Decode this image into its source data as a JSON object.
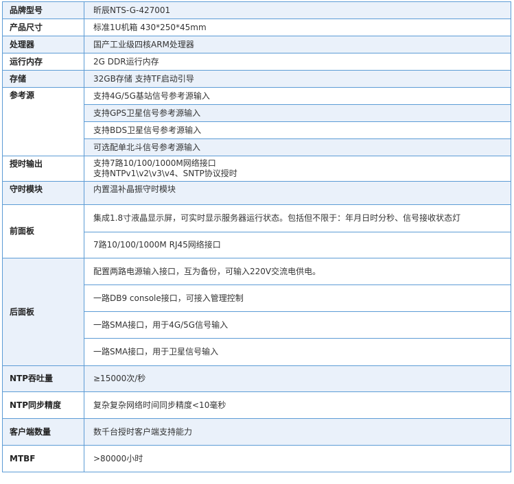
{
  "rows": {
    "model": {
      "label": "品牌型号",
      "value": "昕辰NTS-G-427001"
    },
    "size": {
      "label": "产品尺寸",
      "value": "标准1U机箱  430*250*45mm"
    },
    "cpu": {
      "label": "处理器",
      "value": "国产工业级四核ARM处理器"
    },
    "memory": {
      "label": "运行内存",
      "value": "2G DDR运行内存"
    },
    "storage": {
      "label": "存储",
      "value": "32GB存储 支持TF启动引导"
    },
    "reference": {
      "label": "参考源",
      "items": [
        "支持4G/5G基站信号参考源输入",
        "支持GPS卫星信号参考源输入",
        "支持BDS卫星信号参考源输入",
        "可选配单北斗信号参考源输入"
      ]
    },
    "timing_output": {
      "label": "授时输出",
      "lines": [
        "支持7路10/100/1000M网络接口",
        "支持NTPv1\\v2\\v3\\v4、SNTP协议授时"
      ]
    },
    "holdover": {
      "label": "守时模块",
      "value": "内置温补晶振守时模块"
    },
    "front_panel": {
      "label": "前面板",
      "items": [
        "集成1.8寸液晶显示屏，可实时显示服务器运行状态。包括但不限于：年月日时分秒、信号接收状态灯",
        "7路10/100/1000M RJ45网络接口"
      ]
    },
    "rear_panel": {
      "label": "后面板",
      "items": [
        "配置两路电源输入接口，互为备份，可输入220V交流电供电。",
        "一路DB9 console接口，可接入管理控制",
        "一路SMA接口，用于4G/5G信号输入",
        "一路SMA接口，用于卫星信号输入"
      ]
    },
    "ntp_throughput": {
      "label": "NTP吞吐量",
      "value": "≥15000次/秒"
    },
    "ntp_precision": {
      "label": "NTP同步精度",
      "value": "复杂复杂网络时间同步精度<10毫秒"
    },
    "clients": {
      "label": "客户端数量",
      "value": "数千台授时客户端支持能力"
    },
    "mtbf": {
      "label": "MTBF",
      "value": ">80000小时"
    }
  }
}
